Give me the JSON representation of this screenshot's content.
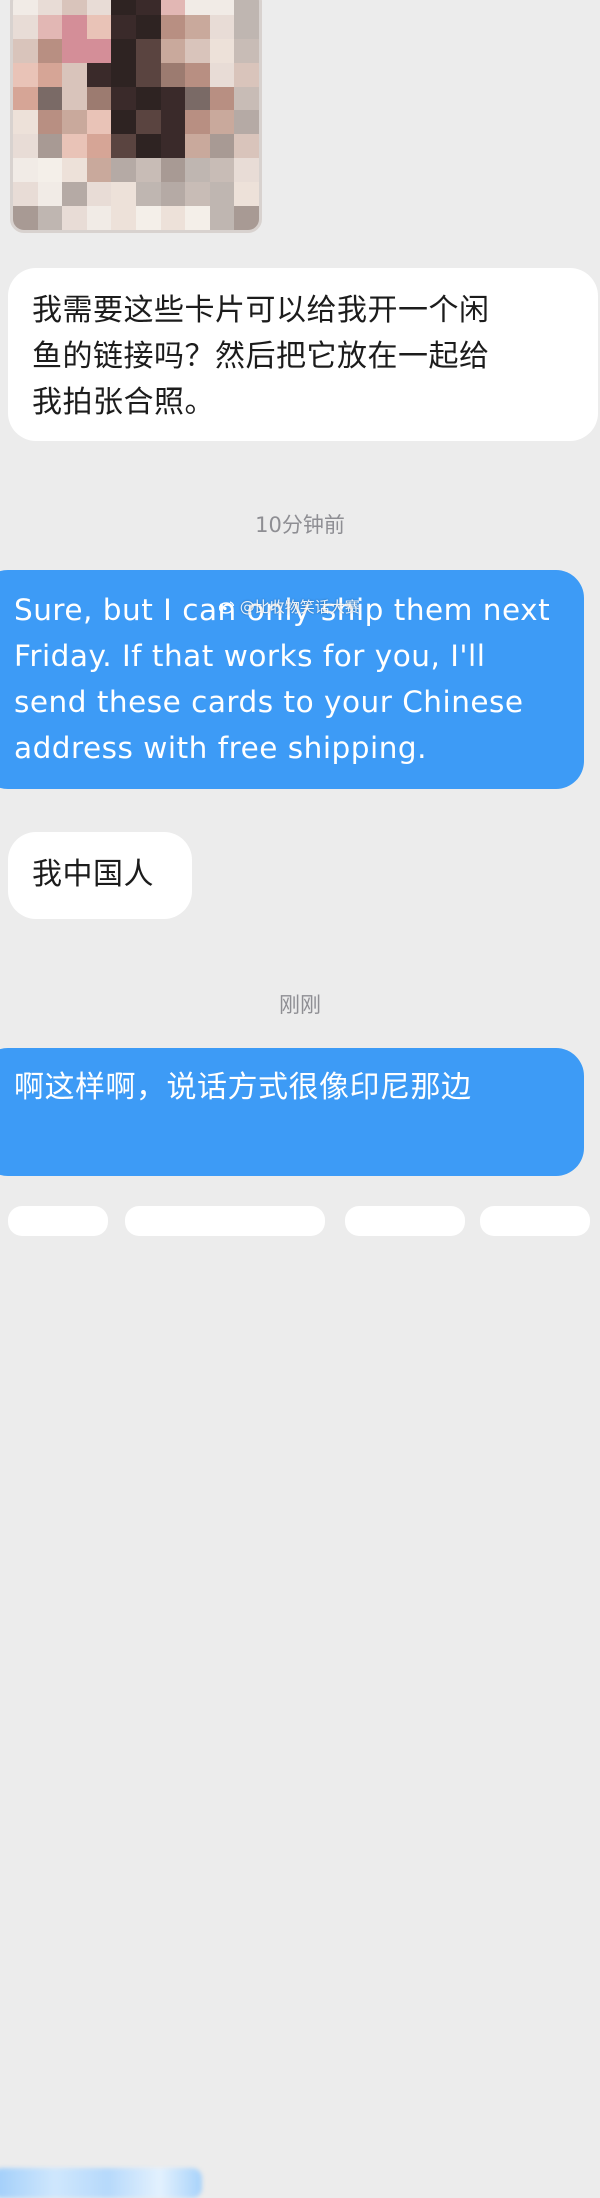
{
  "messages": [
    {
      "direction": "incoming",
      "lines": [
        "我需要这些卡片可以给我开一个闲",
        "鱼的链接吗？然后把它放在一起给",
        "我拍张合照。"
      ]
    },
    {
      "direction": "outgoing",
      "lines": [
        "Sure, but I can only ship them next",
        "Friday. If that works for you, I'll",
        "send these cards to your Chinese",
        "address with free shipping."
      ]
    },
    {
      "direction": "incoming",
      "lines": [
        "我中国人"
      ]
    },
    {
      "direction": "outgoing",
      "lines": [
        "啊这样啊，说话方式很像印尼那边"
      ]
    }
  ],
  "timestamps": [
    "10分钟前",
    "刚刚"
  ],
  "watermark": "@比收物笑话大赛",
  "colors": {
    "background": "#ececec",
    "incoming_bubble": "#ffffff",
    "outgoing_bubble": "#3d9bf6",
    "timestamp_text": "#8e8e93"
  },
  "icons": [
    "weibo-logo-icon"
  ]
}
